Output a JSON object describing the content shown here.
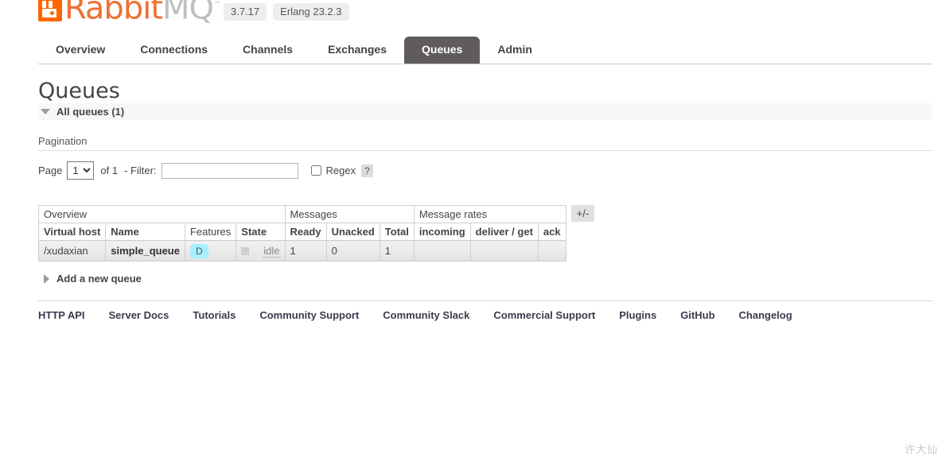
{
  "brand": {
    "name_primary": "Rabbit",
    "name_secondary": "MQ",
    "trademark": "™",
    "logo_color": "#f06f33",
    "version": "3.7.17",
    "erlang_version": "Erlang 23.2.3"
  },
  "nav": {
    "tabs": [
      {
        "label": "Overview",
        "active": false
      },
      {
        "label": "Connections",
        "active": false
      },
      {
        "label": "Channels",
        "active": false
      },
      {
        "label": "Exchanges",
        "active": false
      },
      {
        "label": "Queues",
        "active": true
      },
      {
        "label": "Admin",
        "active": false
      }
    ],
    "active_color": "#605c5c"
  },
  "page": {
    "title": "Queues",
    "section_label": "All queues (1)",
    "section_expanded": true
  },
  "pagination": {
    "heading": "Pagination",
    "page_label": "Page",
    "page_value": "1",
    "page_options": [
      "1"
    ],
    "of_text": "of 1",
    "filter_label": "- Filter:",
    "filter_value": "",
    "filter_placeholder": "",
    "regex_label": "Regex",
    "regex_checked": false,
    "help_label": "?"
  },
  "table": {
    "groups": [
      {
        "label": "Overview",
        "span": 4
      },
      {
        "label": "Messages",
        "span": 3
      },
      {
        "label": "Message rates",
        "span": 3
      }
    ],
    "columns": [
      {
        "label": "Virtual host",
        "bold": true,
        "align": "left"
      },
      {
        "label": "Name",
        "bold": true,
        "align": "left"
      },
      {
        "label": "Features",
        "bold": false,
        "align": "center"
      },
      {
        "label": "State",
        "bold": true,
        "align": "center"
      },
      {
        "label": "Ready",
        "bold": true,
        "align": "right"
      },
      {
        "label": "Unacked",
        "bold": true,
        "align": "right"
      },
      {
        "label": "Total",
        "bold": true,
        "align": "right"
      },
      {
        "label": "incoming",
        "bold": true,
        "align": "left"
      },
      {
        "label": "deliver / get",
        "bold": true,
        "align": "left"
      },
      {
        "label": "ack",
        "bold": true,
        "align": "left"
      }
    ],
    "rows": [
      {
        "virtual_host": "/xudaxian",
        "name": "simple_queue",
        "features": "D",
        "features_color": "#a7efff",
        "state": "idle",
        "ready": "1",
        "unacked": "0",
        "total": "1",
        "incoming": "",
        "deliver_get": "",
        "ack": ""
      }
    ],
    "toggle_columns_label": "+/-"
  },
  "add_queue": {
    "label": "Add a new queue",
    "expanded": false
  },
  "footer": {
    "links": [
      "HTTP API",
      "Server Docs",
      "Tutorials",
      "Community Support",
      "Community Slack",
      "Commercial Support",
      "Plugins",
      "GitHub",
      "Changelog"
    ]
  },
  "watermark": {
    "text": "许大仙"
  }
}
